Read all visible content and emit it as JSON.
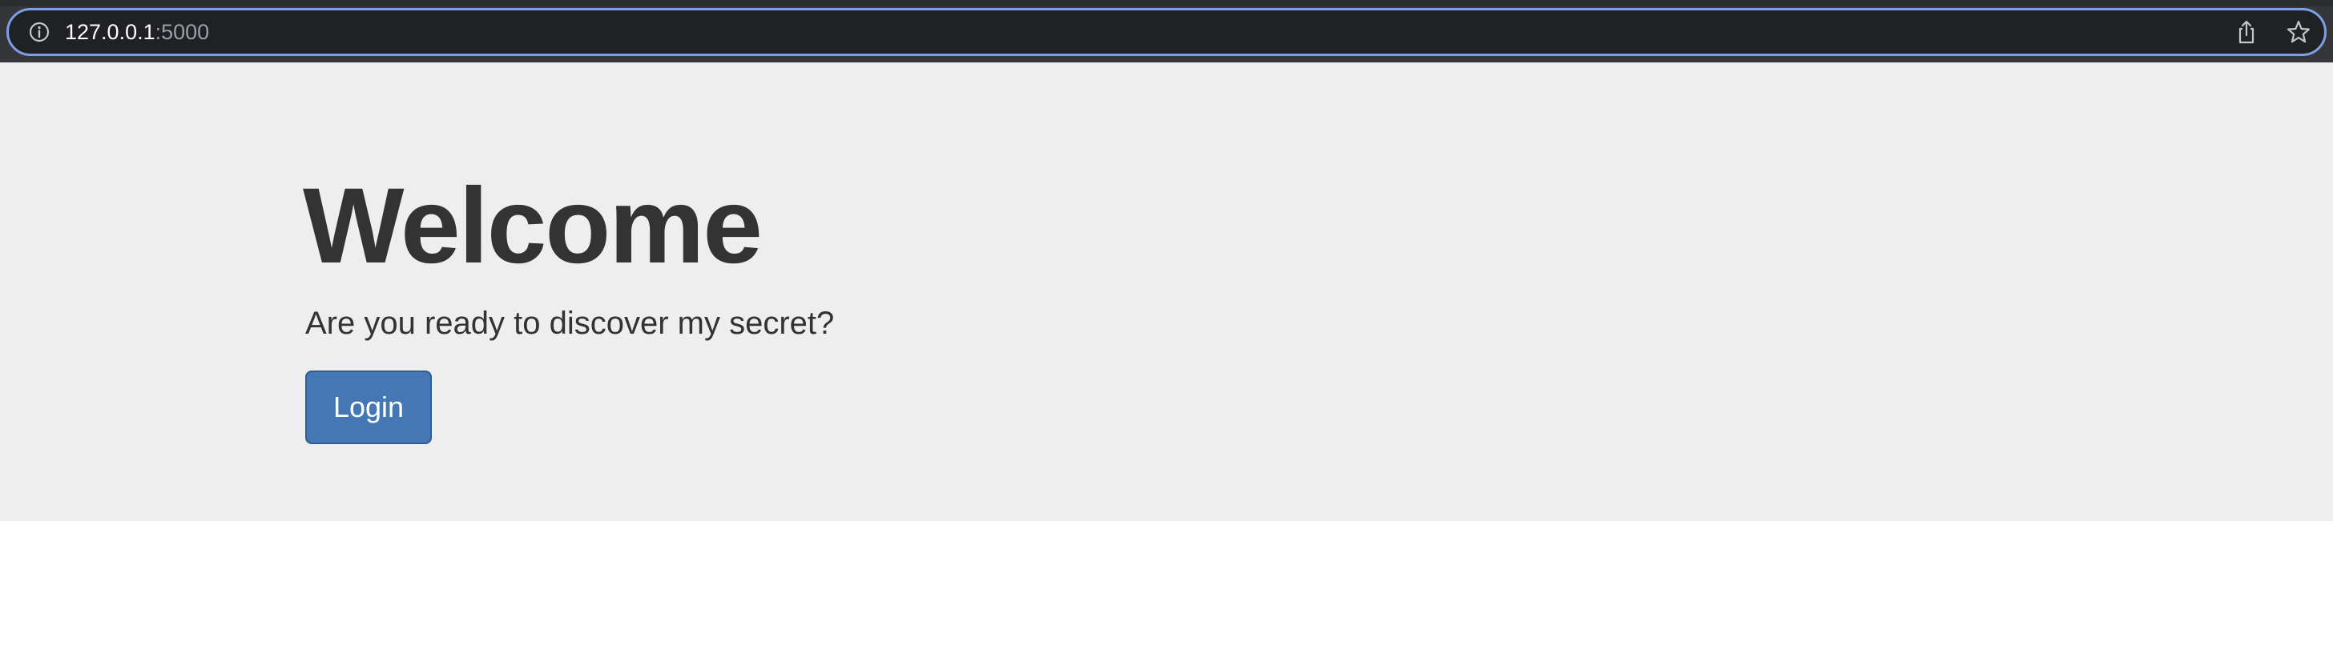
{
  "browser": {
    "url_host": "127.0.0.1",
    "url_port": ":5000",
    "icons": {
      "info": "info-icon",
      "share": "share-icon",
      "bookmark": "star-icon"
    },
    "accent_color": "#7e9ee6"
  },
  "jumbotron": {
    "title": "Welcome",
    "subtitle": "Are you ready to discover my secret?",
    "login_label": "Login",
    "button_color": "#4577b5",
    "background_color": "#eeeeee"
  }
}
